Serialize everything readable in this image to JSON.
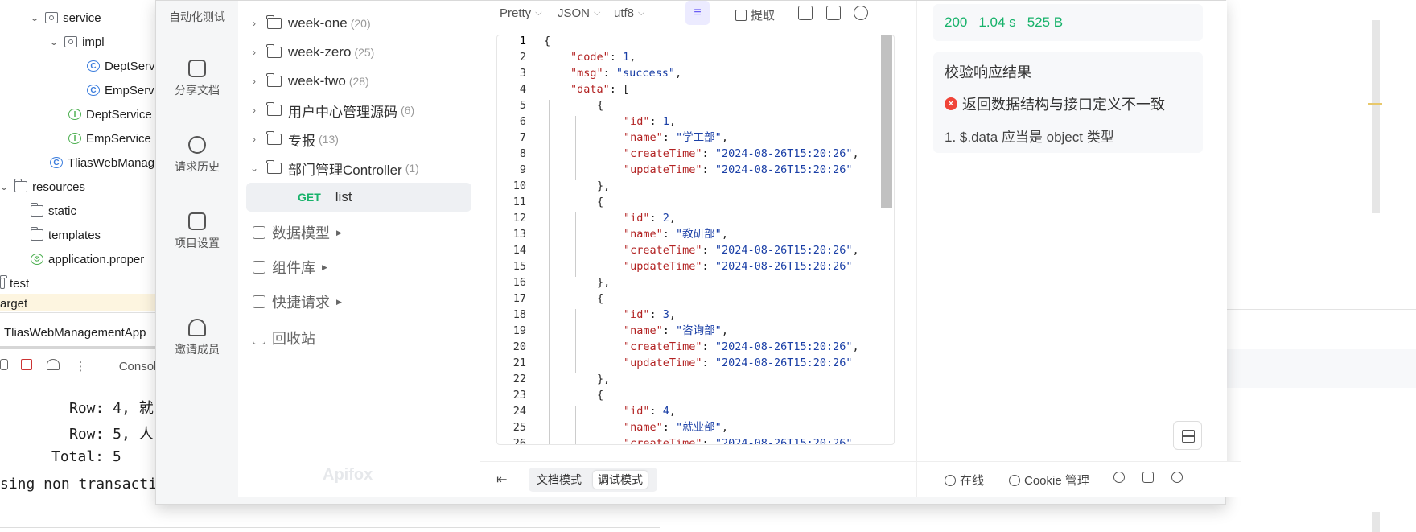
{
  "ide": {
    "tree": {
      "service": "service",
      "impl": "impl",
      "dept_service_impl": "DeptServ",
      "emp_service_impl": "EmpServ",
      "dept_service": "DeptService",
      "emp_service": "EmpService",
      "app_class": "TliasWebManag",
      "resources": "resources",
      "static": "static",
      "templates": "templates",
      "properties": "application.proper",
      "test": "test",
      "target": "arget"
    },
    "run_tab": "TliasWebManagementApp",
    "console_tab": "Consol",
    "console_lines": [
      "Row: 4, 就",
      "Row: 5, 人",
      "Total: 5",
      "sing non transacti"
    ]
  },
  "apifox": {
    "rail": [
      {
        "label": "自动化测试"
      },
      {
        "label": "分享文档"
      },
      {
        "label": "请求历史"
      },
      {
        "label": "项目设置"
      },
      {
        "label": "邀请成员"
      }
    ],
    "tree": [
      {
        "name": "week-one",
        "count": "(20)"
      },
      {
        "name": "week-zero",
        "count": "(25)"
      },
      {
        "name": "week-two",
        "count": "(28)"
      },
      {
        "name": "用户中心管理源码",
        "count": "(6)"
      },
      {
        "name": "专报",
        "count": "(13)"
      },
      {
        "name": "部门管理Controller",
        "count": "(1)"
      }
    ],
    "selected_endpoint": {
      "method": "GET",
      "name": "list"
    },
    "sections": [
      {
        "label": "数据模型"
      },
      {
        "label": "组件库"
      },
      {
        "label": "快捷请求"
      },
      {
        "label": "回收站"
      }
    ],
    "watermark": "Apifox",
    "toolbar": {
      "format": "Pretty",
      "type": "JSON",
      "encoding": "utf8",
      "extract": "提取"
    },
    "code_lines": [
      {
        "n": "1",
        "indent": 0,
        "parts": [
          [
            "p",
            "{"
          ]
        ]
      },
      {
        "n": "2",
        "indent": 1,
        "parts": [
          [
            "k",
            "\"code\""
          ],
          [
            "p",
            ": "
          ],
          [
            "n",
            "1"
          ],
          [
            "p",
            ","
          ]
        ]
      },
      {
        "n": "3",
        "indent": 1,
        "parts": [
          [
            "k",
            "\"msg\""
          ],
          [
            "p",
            ": "
          ],
          [
            "s",
            "\"success\""
          ],
          [
            "p",
            ","
          ]
        ]
      },
      {
        "n": "4",
        "indent": 1,
        "parts": [
          [
            "k",
            "\"data\""
          ],
          [
            "p",
            ": ["
          ]
        ]
      },
      {
        "n": "5",
        "indent": 2,
        "parts": [
          [
            "p",
            "{"
          ]
        ]
      },
      {
        "n": "6",
        "indent": 3,
        "parts": [
          [
            "k",
            "\"id\""
          ],
          [
            "p",
            ": "
          ],
          [
            "n",
            "1"
          ],
          [
            "p",
            ","
          ]
        ]
      },
      {
        "n": "7",
        "indent": 3,
        "parts": [
          [
            "k",
            "\"name\""
          ],
          [
            "p",
            ": "
          ],
          [
            "s",
            "\"学工部\""
          ],
          [
            "p",
            ","
          ]
        ]
      },
      {
        "n": "8",
        "indent": 3,
        "parts": [
          [
            "k",
            "\"createTime\""
          ],
          [
            "p",
            ": "
          ],
          [
            "s",
            "\"2024-08-26T15:20:26\""
          ],
          [
            "p",
            ","
          ]
        ]
      },
      {
        "n": "9",
        "indent": 3,
        "parts": [
          [
            "k",
            "\"updateTime\""
          ],
          [
            "p",
            ": "
          ],
          [
            "s",
            "\"2024-08-26T15:20:26\""
          ]
        ]
      },
      {
        "n": "10",
        "indent": 2,
        "parts": [
          [
            "p",
            "},"
          ]
        ]
      },
      {
        "n": "11",
        "indent": 2,
        "parts": [
          [
            "p",
            "{"
          ]
        ]
      },
      {
        "n": "12",
        "indent": 3,
        "parts": [
          [
            "k",
            "\"id\""
          ],
          [
            "p",
            ": "
          ],
          [
            "n",
            "2"
          ],
          [
            "p",
            ","
          ]
        ]
      },
      {
        "n": "13",
        "indent": 3,
        "parts": [
          [
            "k",
            "\"name\""
          ],
          [
            "p",
            ": "
          ],
          [
            "s",
            "\"教研部\""
          ],
          [
            "p",
            ","
          ]
        ]
      },
      {
        "n": "14",
        "indent": 3,
        "parts": [
          [
            "k",
            "\"createTime\""
          ],
          [
            "p",
            ": "
          ],
          [
            "s",
            "\"2024-08-26T15:20:26\""
          ],
          [
            "p",
            ","
          ]
        ]
      },
      {
        "n": "15",
        "indent": 3,
        "parts": [
          [
            "k",
            "\"updateTime\""
          ],
          [
            "p",
            ": "
          ],
          [
            "s",
            "\"2024-08-26T15:20:26\""
          ]
        ]
      },
      {
        "n": "16",
        "indent": 2,
        "parts": [
          [
            "p",
            "},"
          ]
        ]
      },
      {
        "n": "17",
        "indent": 2,
        "parts": [
          [
            "p",
            "{"
          ]
        ]
      },
      {
        "n": "18",
        "indent": 3,
        "parts": [
          [
            "k",
            "\"id\""
          ],
          [
            "p",
            ": "
          ],
          [
            "n",
            "3"
          ],
          [
            "p",
            ","
          ]
        ]
      },
      {
        "n": "19",
        "indent": 3,
        "parts": [
          [
            "k",
            "\"name\""
          ],
          [
            "p",
            ": "
          ],
          [
            "s",
            "\"咨询部\""
          ],
          [
            "p",
            ","
          ]
        ]
      },
      {
        "n": "20",
        "indent": 3,
        "parts": [
          [
            "k",
            "\"createTime\""
          ],
          [
            "p",
            ": "
          ],
          [
            "s",
            "\"2024-08-26T15:20:26\""
          ],
          [
            "p",
            ","
          ]
        ]
      },
      {
        "n": "21",
        "indent": 3,
        "parts": [
          [
            "k",
            "\"updateTime\""
          ],
          [
            "p",
            ": "
          ],
          [
            "s",
            "\"2024-08-26T15:20:26\""
          ]
        ]
      },
      {
        "n": "22",
        "indent": 2,
        "parts": [
          [
            "p",
            "},"
          ]
        ]
      },
      {
        "n": "23",
        "indent": 2,
        "parts": [
          [
            "p",
            "{"
          ]
        ]
      },
      {
        "n": "24",
        "indent": 3,
        "parts": [
          [
            "k",
            "\"id\""
          ],
          [
            "p",
            ": "
          ],
          [
            "n",
            "4"
          ],
          [
            "p",
            ","
          ]
        ]
      },
      {
        "n": "25",
        "indent": 3,
        "parts": [
          [
            "k",
            "\"name\""
          ],
          [
            "p",
            ": "
          ],
          [
            "s",
            "\"就业部\""
          ],
          [
            "p",
            ","
          ]
        ]
      },
      {
        "n": "26",
        "indent": 3,
        "parts": [
          [
            "k",
            "\"createTime\""
          ],
          [
            "p",
            ": "
          ],
          [
            "s",
            "\"2024-08-26T15:20:26\""
          ]
        ]
      }
    ],
    "bottom": {
      "doc_mode": "文档模式",
      "debug_mode": "调试模式",
      "online": "在线",
      "cookie": "Cookie 管理"
    },
    "response": {
      "status": "200",
      "time": "1.04 s",
      "size": "525 B"
    },
    "validation": {
      "title": "校验响应结果",
      "error": "返回数据结构与接口定义不一致",
      "detail": "1. $.data 应当是 object 类型"
    }
  }
}
